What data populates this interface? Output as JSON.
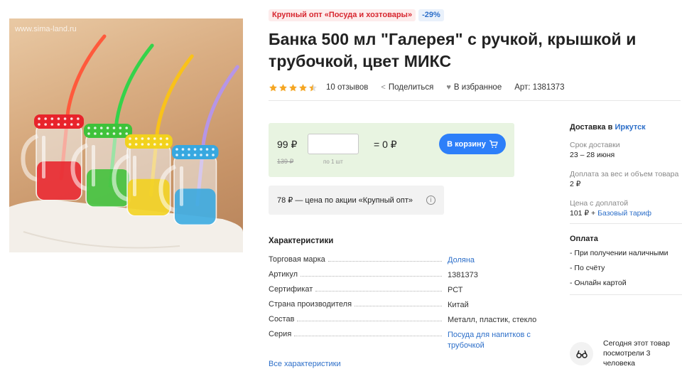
{
  "image": {
    "watermark": "www.sima-land.ru",
    "jar_colors": [
      "#e8232b",
      "#3fc23a",
      "#f2d21d",
      "#37a8e0"
    ],
    "straw_colors": [
      "#ff5a3c",
      "#35d34a",
      "#f9c21a",
      "#b695e6"
    ]
  },
  "badges": {
    "promo": "Крупный опт «Посуда и хозтовары»",
    "discount": "-29%"
  },
  "title": "Банка 500 мл \"Галерея\" с ручкой, крышкой и трубочкой, цвет МИКС",
  "meta": {
    "rating": 4.5,
    "reviews": "10 отзывов",
    "share": "Поделиться",
    "favorite": "В избранное",
    "article": "Арт: 1381373"
  },
  "buy": {
    "price": "99 ₽",
    "old_price": "139 ₽",
    "qty_placeholder": "",
    "qty_note": "по 1 шт",
    "total": "= 0 ₽",
    "cart_label": "В корзину",
    "promo_price": "78 ₽ — цена по акции «Крупный опт»"
  },
  "characteristics": {
    "title": "Характеристики",
    "rows": [
      {
        "key": "Торговая марка",
        "value": "Доляна",
        "link": true
      },
      {
        "key": "Артикул",
        "value": "1381373",
        "link": false
      },
      {
        "key": "Сертификат",
        "value": "РСТ",
        "link": false
      },
      {
        "key": "Страна производителя",
        "value": "Китай",
        "link": false
      },
      {
        "key": "Состав",
        "value": "Металл, пластик, стекло",
        "link": false
      },
      {
        "key": "Серия",
        "value": "Посуда для напитков с трубочкой",
        "link": true
      }
    ],
    "all_link": "Все характеристики"
  },
  "delivery": {
    "heading": "Доставка в",
    "city": "Иркутск",
    "term_label": "Срок доставки",
    "term_value": "23 – 28 июня",
    "surcharge_label": "Доплата за вес и объем товара",
    "surcharge_value": "2 ₽",
    "price_label": "Цена с доплатой",
    "price_value": "101 ₽ +",
    "tariff_link": "Базовый тариф"
  },
  "payment": {
    "heading": "Оплата",
    "items": [
      "- При получении наличными",
      "- По счёту",
      "- Онлайн картой"
    ]
  },
  "viewers": {
    "text": "Сегодня этот товар посмотрели 3 человека"
  }
}
